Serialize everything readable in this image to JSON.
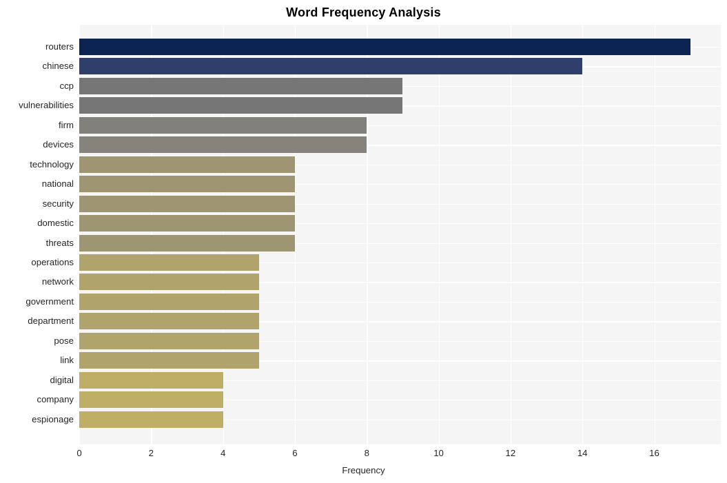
{
  "chart_data": {
    "type": "bar",
    "orientation": "horizontal",
    "title": "Word Frequency Analysis",
    "xlabel": "Frequency",
    "ylabel": "",
    "xlim": [
      0,
      17.85
    ],
    "xticks": [
      0,
      2,
      4,
      6,
      8,
      10,
      12,
      14,
      16
    ],
    "grid": true,
    "legend": null,
    "categories": [
      "routers",
      "chinese",
      "ccp",
      "vulnerabilities",
      "firm",
      "devices",
      "technology",
      "national",
      "security",
      "domestic",
      "threats",
      "operations",
      "network",
      "government",
      "department",
      "pose",
      "link",
      "digital",
      "company",
      "espionage"
    ],
    "values": [
      17,
      14,
      9,
      9,
      8,
      8,
      6,
      6,
      6,
      6,
      6,
      5,
      5,
      5,
      5,
      5,
      5,
      4,
      4,
      4
    ],
    "bar_colors": [
      "#0a2351",
      "#2f3f6c",
      "#767676",
      "#767676",
      "#82807a",
      "#85837c",
      "#9e9672",
      "#9e9672",
      "#9e9672",
      "#9e9672",
      "#9e9672",
      "#b0a46c",
      "#b0a46c",
      "#b0a46c",
      "#b0a46c",
      "#b0a46c",
      "#b0a46c",
      "#bfae66",
      "#bfae66",
      "#bfae66"
    ],
    "plot_background": "#f5f5f5",
    "grid_color": "#ffffff",
    "figure_background": "#ffffff",
    "text_color": "#262626"
  }
}
